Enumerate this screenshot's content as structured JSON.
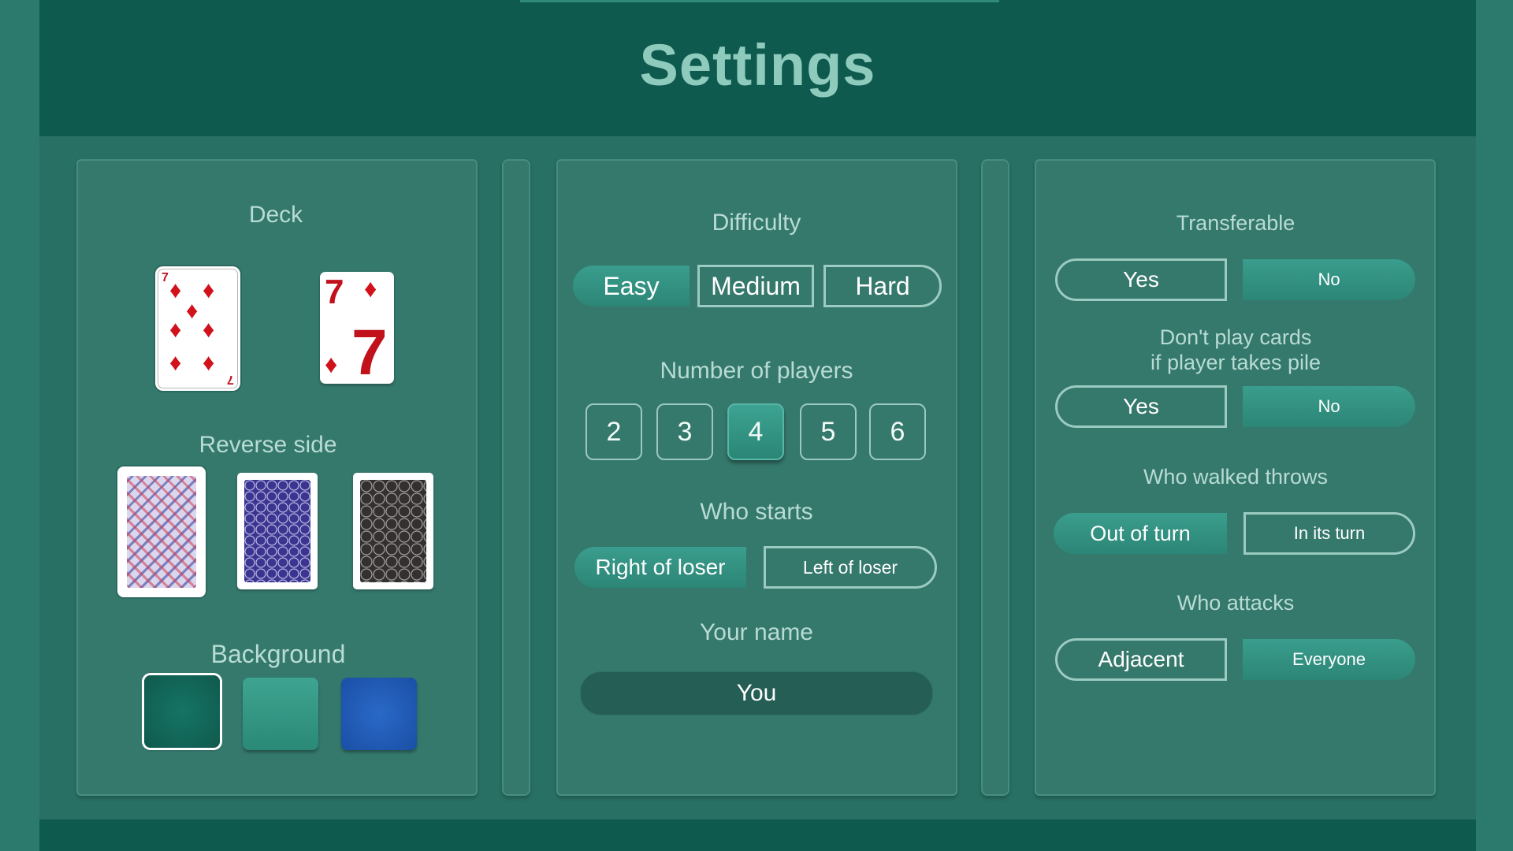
{
  "header": {
    "title": "Settings"
  },
  "deck": {
    "label": "Deck",
    "cards": [
      {
        "rank": "7",
        "suit": "♦",
        "style": "classic",
        "selected": true
      },
      {
        "rank": "7",
        "suit": "♦",
        "style": "large-index",
        "selected": false
      }
    ]
  },
  "reverse_side": {
    "label": "Reverse side",
    "options": [
      {
        "pattern": "plaid",
        "selected": true
      },
      {
        "pattern": "blue-rings",
        "selected": false
      },
      {
        "pattern": "dark-lace",
        "selected": false
      }
    ]
  },
  "background": {
    "label": "Background",
    "options": [
      {
        "color": "#0f5e50",
        "selected": true
      },
      {
        "color": "#2d9a85",
        "selected": false
      },
      {
        "color": "#1f57b0",
        "selected": false
      }
    ]
  },
  "difficulty": {
    "label": "Difficulty",
    "options": [
      "Easy",
      "Medium",
      "Hard"
    ],
    "selected": "Easy"
  },
  "players": {
    "label": "Number of players",
    "options": [
      "2",
      "3",
      "4",
      "5",
      "6"
    ],
    "selected": "4"
  },
  "who_starts": {
    "label": "Who starts",
    "options": [
      "Right of loser",
      "Left of loser"
    ],
    "selected": "Right of loser"
  },
  "your_name": {
    "label": "Your name",
    "value": "You"
  },
  "transferable": {
    "label": "Transferable",
    "yes": "Yes",
    "no": "No",
    "selected": "No"
  },
  "dont_play": {
    "label_line1": "Don't play cards",
    "label_line2": "if player takes pile",
    "yes": "Yes",
    "no": "No",
    "selected": "No"
  },
  "who_walked": {
    "label": "Who walked throws",
    "options": [
      "Out of turn",
      "In its turn"
    ],
    "selected": "Out of turn"
  },
  "who_attacks": {
    "label": "Who attacks",
    "options": [
      "Adjacent",
      "Everyone"
    ],
    "selected": "Everyone"
  },
  "colors": {
    "header_bg": "#0e5a4e",
    "panel_bg": "#35786c",
    "accent": "#34978a",
    "label_text": "#b8dcd4",
    "title_text": "#8fcbbd"
  }
}
